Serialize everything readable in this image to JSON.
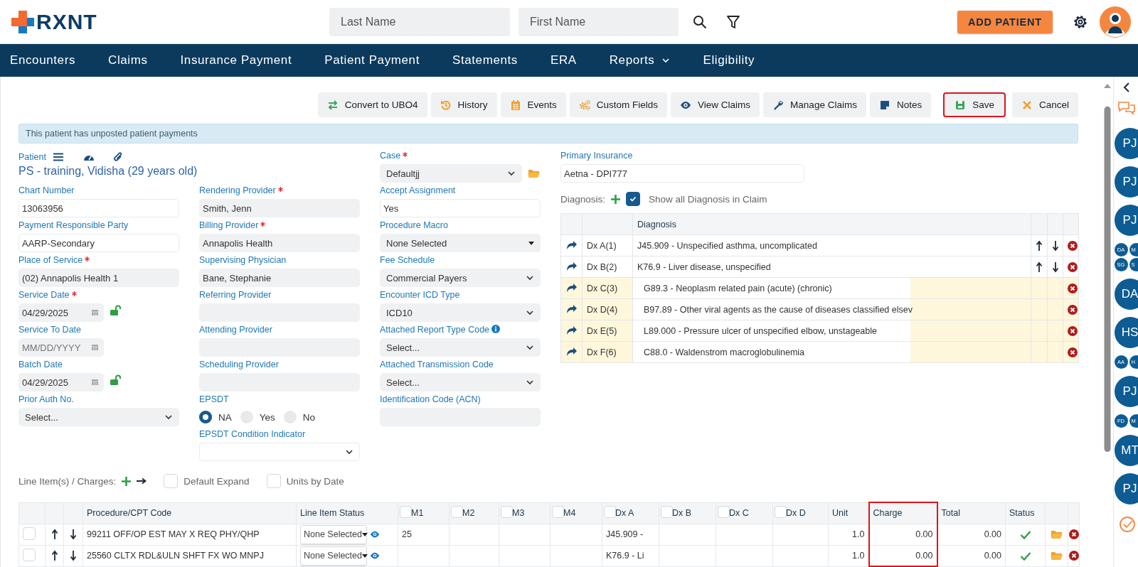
{
  "header": {
    "logo": "RXNT",
    "search_fields": [
      {
        "placeholder": "Last Name"
      },
      {
        "placeholder": "First Name"
      }
    ],
    "add_button": "ADD PATIENT"
  },
  "nav": [
    {
      "label": "Encounters",
      "dropdown": false
    },
    {
      "label": "Claims",
      "dropdown": false
    },
    {
      "label": "Insurance Payment",
      "dropdown": false
    },
    {
      "label": "Patient Payment",
      "dropdown": false
    },
    {
      "label": "Statements",
      "dropdown": false
    },
    {
      "label": "ERA",
      "dropdown": false
    },
    {
      "label": "Reports",
      "dropdown": true
    },
    {
      "label": "Eligibility",
      "dropdown": false
    }
  ],
  "toolbar": [
    {
      "label": "Convert to UBO4",
      "kind": "convert",
      "highlighted": false
    },
    {
      "label": "History",
      "kind": "history",
      "highlighted": false
    },
    {
      "label": "Events",
      "kind": "events",
      "highlighted": false
    },
    {
      "label": "Custom Fields",
      "kind": "custom",
      "highlighted": false
    },
    {
      "label": "View Claims",
      "kind": "view",
      "highlighted": false
    },
    {
      "label": "Manage Claims",
      "kind": "manage",
      "highlighted": false
    },
    {
      "label": "Notes",
      "kind": "notes",
      "highlighted": false
    },
    {
      "label": "Save",
      "kind": "save",
      "highlighted": true
    },
    {
      "label": "Cancel",
      "kind": "cancel",
      "highlighted": false
    }
  ],
  "alert": "This patient has unposted patient payments",
  "patient": {
    "label": "Patient",
    "name": "PS - training, Vidisha (29 years old)"
  },
  "form_columns": [
    [
      {
        "label": "Chart Number",
        "kind": "text",
        "value": "13063956",
        "readonly": false,
        "required": false
      },
      {
        "label": "Payment Responsible Party",
        "kind": "text",
        "value": "AARP-Secondary",
        "readonly": false,
        "required": false
      },
      {
        "label": "Place of Service",
        "kind": "text",
        "value": "(02) Annapolis Health 1",
        "readonly": true,
        "required": true
      },
      {
        "label": "Service Date",
        "kind": "date",
        "value": "04/29/2025",
        "required": true,
        "lock": true
      },
      {
        "label": "Service To Date",
        "kind": "date",
        "placeholder": "MM/DD/YYYY",
        "required": false,
        "lock": false
      },
      {
        "label": "Batch Date",
        "kind": "date",
        "value": "04/29/2025",
        "required": false,
        "lock": true
      },
      {
        "label": "Prior Auth No.",
        "kind": "select",
        "value": "Select...",
        "readonly": true,
        "required": false
      }
    ],
    [
      {
        "label": "Rendering Provider",
        "kind": "text",
        "value": "Smith, Jenn",
        "readonly": true,
        "required": true
      },
      {
        "label": "Billing Provider",
        "kind": "text",
        "value": "Annapolis Health",
        "readonly": true,
        "required": true
      },
      {
        "label": "Supervising Physician",
        "kind": "text",
        "value": "Bane, Stephanie",
        "readonly": true,
        "required": false
      },
      {
        "label": "Referring Provider",
        "kind": "text",
        "readonly": true,
        "required": false
      },
      {
        "label": "Attending Provider",
        "kind": "text",
        "readonly": true,
        "required": false
      },
      {
        "label": "Scheduling Provider",
        "kind": "text",
        "readonly": true,
        "required": false
      },
      {
        "label": "EPSDT",
        "kind": "radio",
        "required": false,
        "options": [
          {
            "label": "NA",
            "selected": true
          },
          {
            "label": "Yes",
            "selected": false
          },
          {
            "label": "No",
            "selected": false
          }
        ]
      },
      {
        "label": "EPSDT Condition Indicator",
        "kind": "select",
        "readonly": false,
        "required": false
      }
    ],
    [
      {
        "label": "Case",
        "kind": "select",
        "value": "Defaultjj",
        "readonly": true,
        "required": true,
        "folder": true
      },
      {
        "label": "Accept Assignment",
        "kind": "text",
        "value": "Yes",
        "readonly": false,
        "required": false
      },
      {
        "label": "Procedure Macro",
        "kind": "dropdown",
        "value": "None Selected",
        "readonly": true,
        "required": false
      },
      {
        "label": "Fee Schedule",
        "kind": "select",
        "value": "Commercial Payers",
        "readonly": true,
        "required": false
      },
      {
        "label": "Encounter ICD Type",
        "kind": "select",
        "value": "ICD10",
        "readonly": true,
        "required": false
      },
      {
        "label": "Attached Report Type Code",
        "kind": "select",
        "value": "Select...",
        "readonly": true,
        "required": false,
        "info": true
      },
      {
        "label": "Attached Transmission Code",
        "kind": "select",
        "value": "Select...",
        "readonly": true,
        "required": false
      },
      {
        "label": "Identification Code (ACN)",
        "kind": "text",
        "readonly": true,
        "required": false
      }
    ]
  ],
  "insurance": {
    "label": "Primary Insurance",
    "value": "Aetna - DPI777"
  },
  "diagnosis": {
    "label": "Diagnosis:",
    "show_all": {
      "label": "Show all Diagnosis in Claim",
      "checked": true
    },
    "column": "Diagnosis",
    "rows": [
      {
        "code": "Dx A(1)",
        "text": "J45.909 - Unspecified asthma, uncomplicated",
        "movable": true
      },
      {
        "code": "Dx B(2)",
        "text": "K76.9 - Liver disease, unspecified",
        "movable": true
      },
      {
        "code": "Dx C(3)",
        "text": "G89.3 - Neoplasm related pain (acute) (chronic)",
        "movable": false
      },
      {
        "code": "Dx D(4)",
        "text": "B97.89 - Other viral agents as the cause of diseases classified elsev",
        "movable": false
      },
      {
        "code": "Dx E(5)",
        "text": "L89.000 - Pressure ulcer of unspecified elbow, unstageable",
        "movable": false
      },
      {
        "code": "Dx F(6)",
        "text": "C88.0 - Waldenstrom macroglobulinemia",
        "movable": false
      }
    ]
  },
  "line_items": {
    "label": "Line Item(s) / Charges:",
    "options": [
      {
        "label": "Default Expand",
        "checked": false
      },
      {
        "label": "Units by Date",
        "checked": false
      }
    ],
    "columns": [
      {
        "label": "Procedure/CPT Code",
        "kind": "text",
        "highlighted": false
      },
      {
        "label": "Line Item Status",
        "kind": "text",
        "highlighted": false
      },
      {
        "label": "M1",
        "kind": "checkbox",
        "checked": false,
        "highlighted": false
      },
      {
        "label": "M2",
        "kind": "checkbox",
        "checked": false,
        "highlighted": false
      },
      {
        "label": "M3",
        "kind": "checkbox",
        "checked": false,
        "highlighted": false
      },
      {
        "label": "M4",
        "kind": "checkbox",
        "checked": false,
        "highlighted": false
      },
      {
        "label": "Dx A",
        "kind": "checkbox",
        "checked": false,
        "highlighted": false
      },
      {
        "label": "Dx B",
        "kind": "checkbox",
        "checked": false,
        "highlighted": false
      },
      {
        "label": "Dx C",
        "kind": "checkbox",
        "checked": false,
        "highlighted": false
      },
      {
        "label": "Dx D",
        "kind": "checkbox",
        "checked": false,
        "highlighted": false
      },
      {
        "label": "Unit",
        "kind": "text",
        "highlighted": false
      },
      {
        "label": "Charge",
        "kind": "text",
        "highlighted": true
      },
      {
        "label": "Total",
        "kind": "text",
        "highlighted": false
      },
      {
        "label": "Status",
        "kind": "text",
        "highlighted": false
      }
    ],
    "rows": [
      {
        "checked": false,
        "procedure": "99211 OFF/OP EST MAY X REQ PHY/QHP",
        "status": "None Selected",
        "modifiers": [
          "25"
        ],
        "dx": [
          "J45.909 -"
        ],
        "unit": "1.0",
        "charge": "0.00",
        "total": "0.00",
        "ok": true
      },
      {
        "checked": false,
        "procedure": "25560 CLTX RDL&ULN SHFT FX WO MNPJ",
        "status": "None Selected",
        "dx": [
          "K76.9 - Li"
        ],
        "unit": "1.0",
        "charge": "0.00",
        "total": "0.00",
        "ok": true
      }
    ]
  },
  "side_panel": {
    "avatars": [
      {
        "kind": "avatar",
        "initials": "PJ"
      },
      {
        "kind": "avatar",
        "initials": "PJ"
      },
      {
        "kind": "avatar",
        "initials": "PJ"
      },
      {
        "kind": "group",
        "initials": [
          "DA",
          "M",
          "SG",
          "S"
        ]
      },
      {
        "kind": "avatar",
        "initials": "DA"
      },
      {
        "kind": "avatar",
        "initials": "HS"
      },
      {
        "kind": "group",
        "initials": [
          "AA",
          "H"
        ]
      },
      {
        "kind": "avatar",
        "initials": "PJ"
      },
      {
        "kind": "group",
        "initials": [
          "FD",
          "M"
        ]
      },
      {
        "kind": "avatar",
        "initials": "MT"
      },
      {
        "kind": "avatar",
        "initials": "PJ"
      }
    ]
  }
}
